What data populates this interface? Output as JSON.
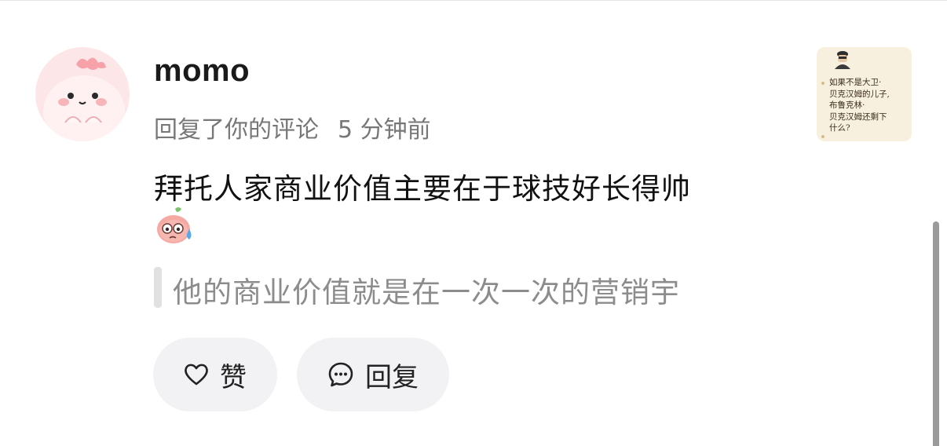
{
  "comment": {
    "username": "momo",
    "action": "回复了你的评论",
    "time": "5 分钟前",
    "text": "拜托人家商业价值主要在于球技好长得帅",
    "emoji": "sweat-face-emoji",
    "quote": "他的商业价值就是在一次一次的营销宇"
  },
  "actions": {
    "like_label": "赞",
    "reply_label": "回复"
  },
  "thumbnail": {
    "lines": [
      "如果不是大卫·",
      "贝克汉姆的儿子,",
      "布鲁克林·",
      "贝克汉姆还剩下",
      "什么?"
    ]
  },
  "colors": {
    "avatar_bg": "#fbe3e6",
    "pill_bg": "#f2f2f4",
    "thumb_bg": "#f7f0df",
    "meta_text": "#777777",
    "quote_text": "#8c8c8c"
  }
}
